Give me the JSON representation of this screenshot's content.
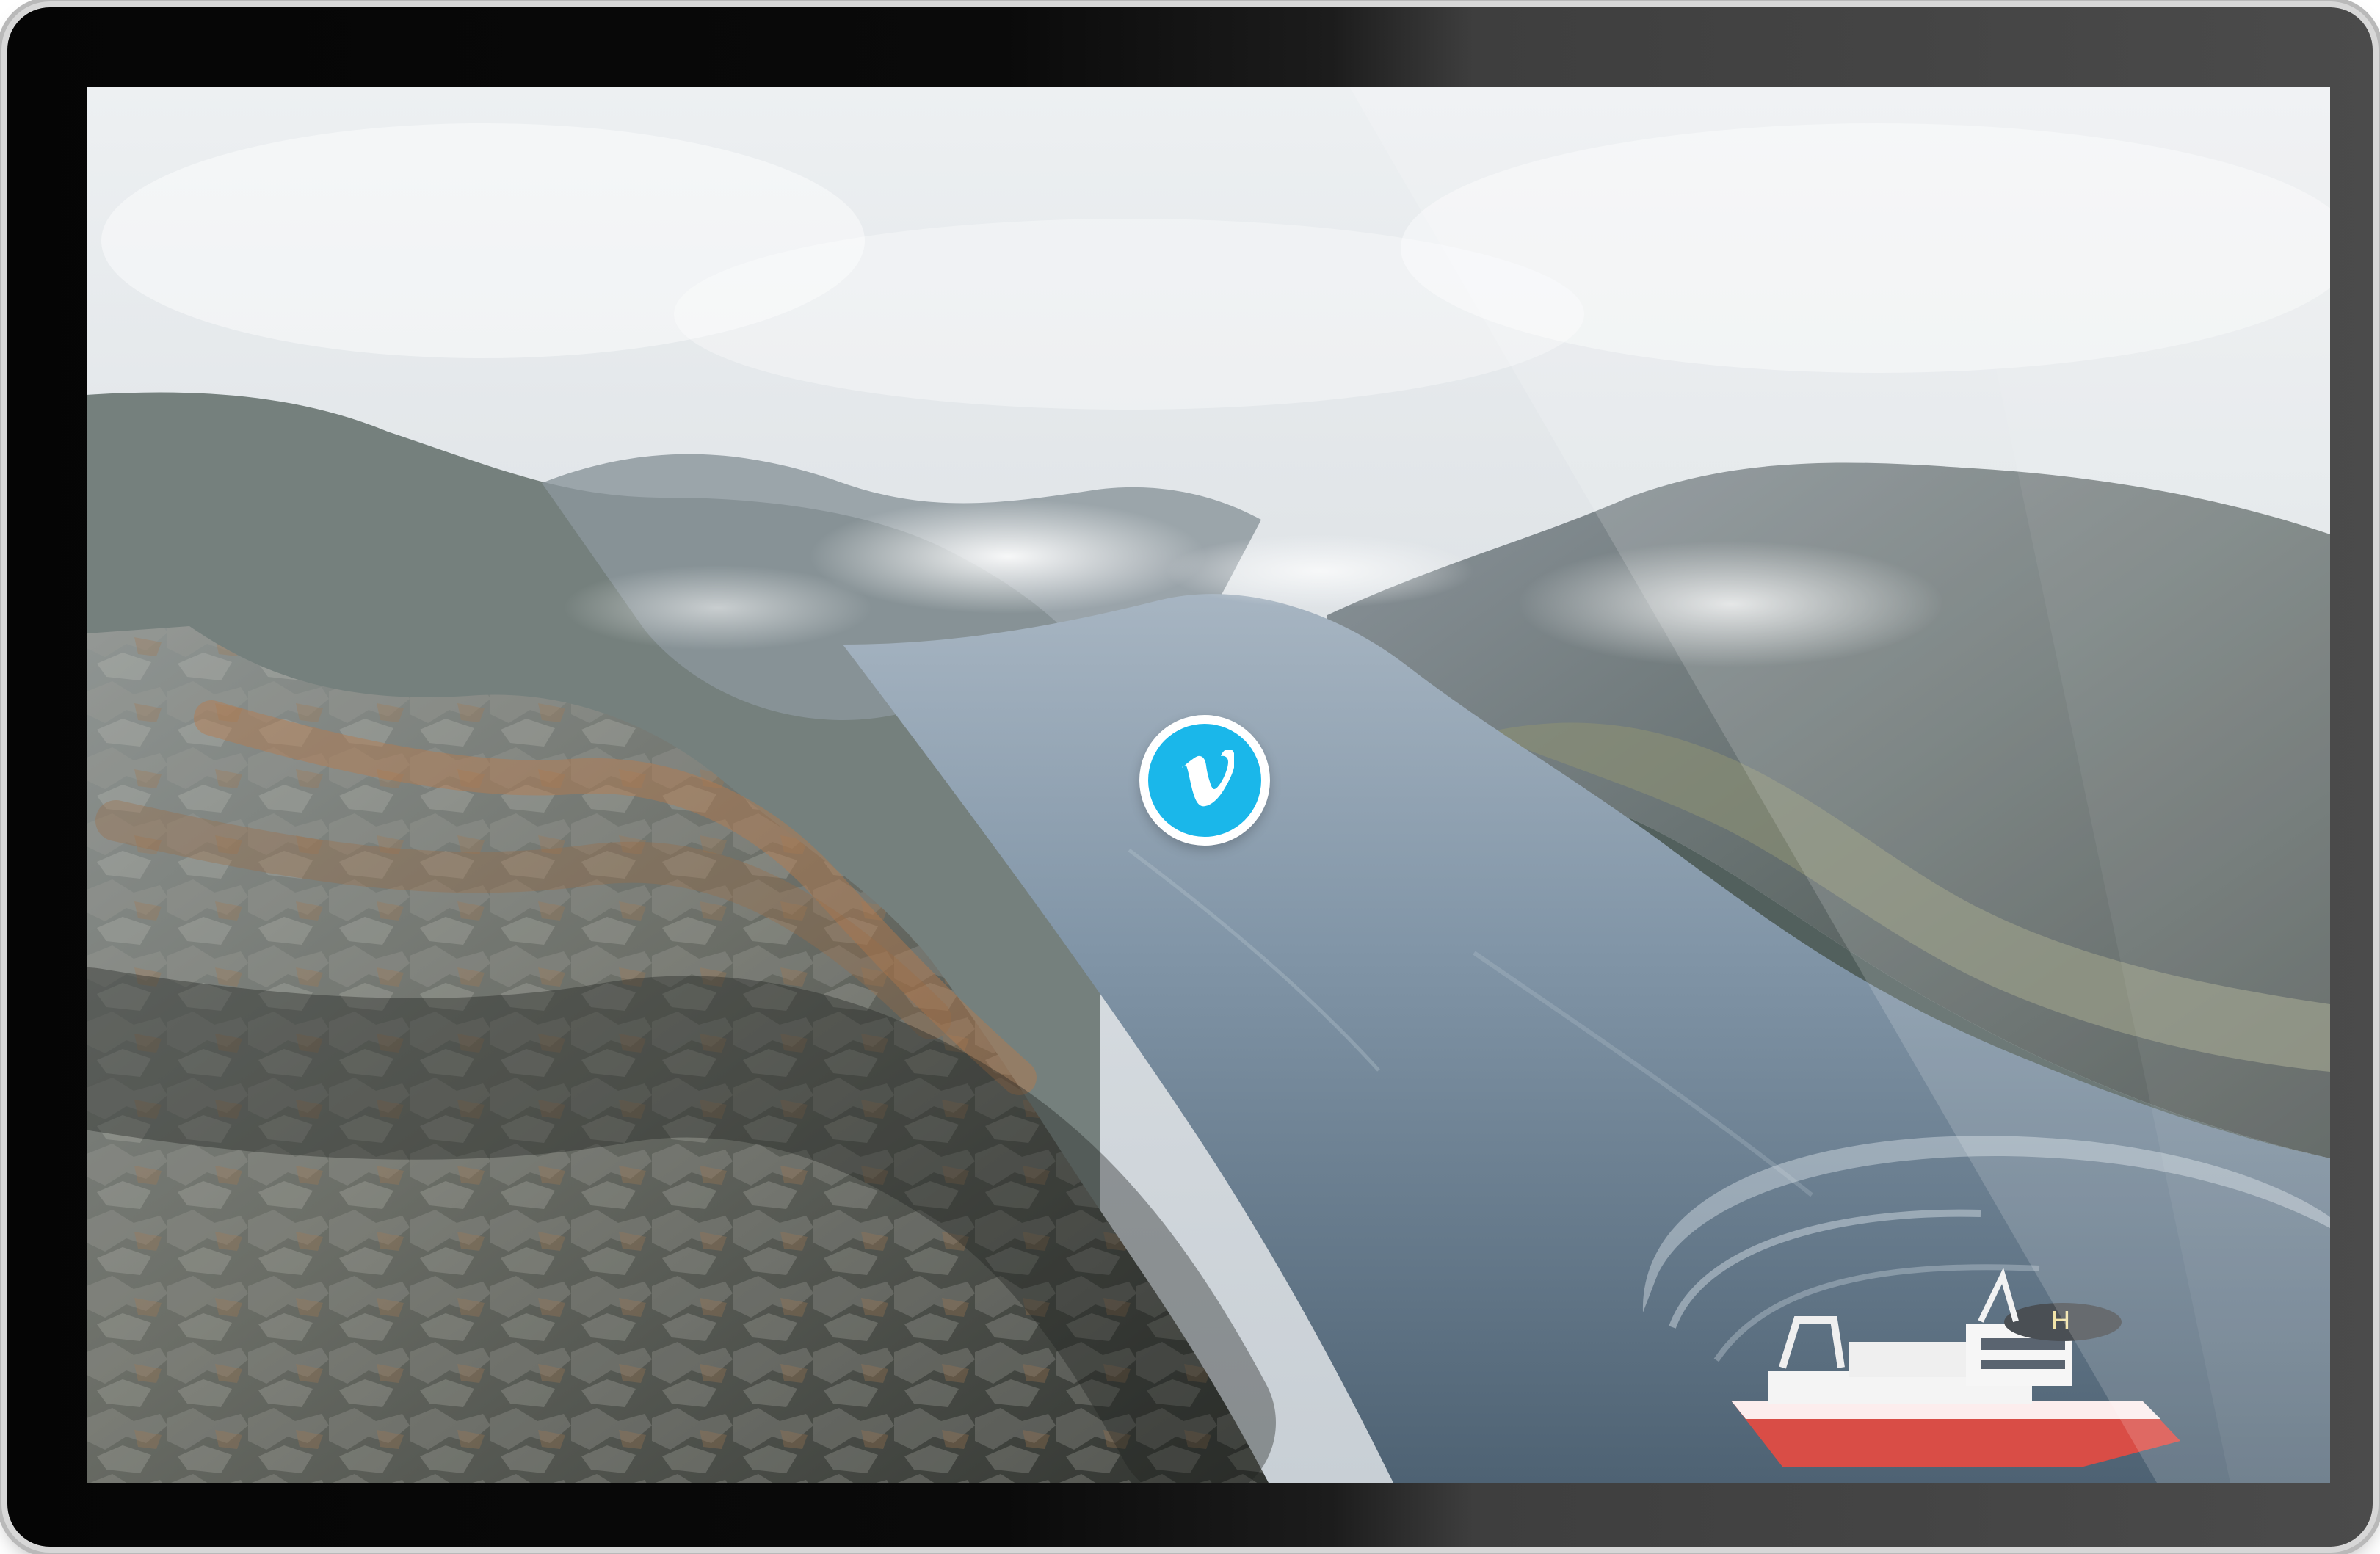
{
  "device": {
    "frame_color": "#0b0b0b",
    "screen_bg": "#c8d0d7"
  },
  "video": {
    "play_icon": "vimeo-icon",
    "accent_color": "#1ab7ea"
  }
}
